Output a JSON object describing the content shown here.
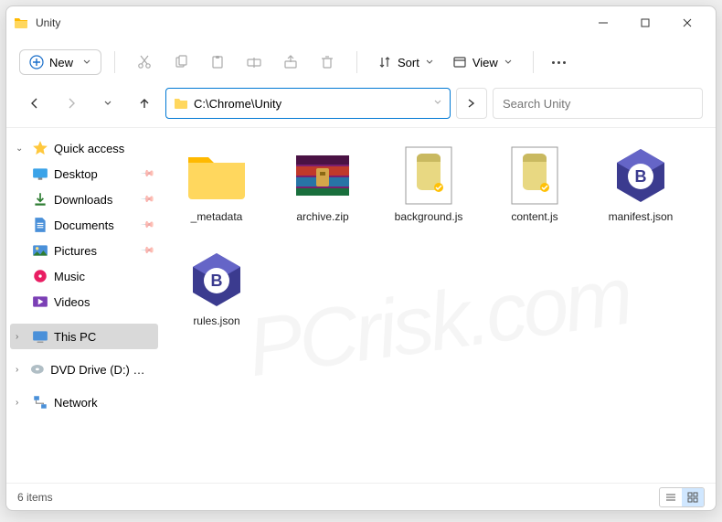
{
  "window": {
    "title": "Unity"
  },
  "toolbar": {
    "new_label": "New",
    "sort_label": "Sort",
    "view_label": "View"
  },
  "nav": {
    "path": "C:\\Chrome\\Unity",
    "search_placeholder": "Search Unity"
  },
  "sidebar": {
    "quick_access": "Quick access",
    "items": [
      {
        "label": "Desktop"
      },
      {
        "label": "Downloads"
      },
      {
        "label": "Documents"
      },
      {
        "label": "Pictures"
      },
      {
        "label": "Music"
      },
      {
        "label": "Videos"
      }
    ],
    "this_pc": "This PC",
    "dvd": "DVD Drive (D:) CCCC",
    "network": "Network"
  },
  "files": [
    {
      "name": "_metadata",
      "type": "folder"
    },
    {
      "name": "archive.zip",
      "type": "archive"
    },
    {
      "name": "background.js",
      "type": "script"
    },
    {
      "name": "content.js",
      "type": "script"
    },
    {
      "name": "manifest.json",
      "type": "json"
    },
    {
      "name": "rules.json",
      "type": "json"
    }
  ],
  "status": {
    "count": "6 items"
  }
}
